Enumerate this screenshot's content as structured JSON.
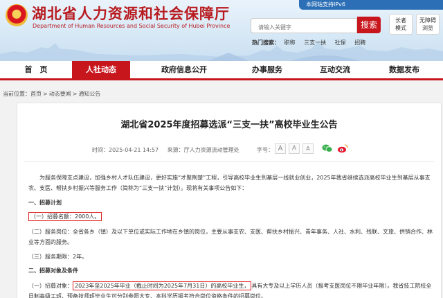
{
  "header": {
    "title": "湖北省人力资源和社会保障厅",
    "subtitle": "Department of Human Resources and Social Security of Hubei Province",
    "ipv6_text": "本网站支持IPv6",
    "search": {
      "placeholder": "请输入关键字",
      "button": "搜索"
    },
    "hot": {
      "label": "热门搜索：",
      "words": [
        "职称",
        "三支一扶",
        "社保",
        "招聘"
      ]
    },
    "elder_line1": "长者",
    "elder_line2": "模式",
    "barrier_line1": "无障碍",
    "barrier_line2": "浏览"
  },
  "nav": {
    "items": [
      "首　页",
      "人社动态",
      "政府信息公开",
      "办事服务",
      "互动交流",
      "数据发布"
    ],
    "active_index": 1
  },
  "breadcrumb": {
    "prefix": "当前位置：",
    "items": [
      "首页",
      "动态要闻",
      "通知公告"
    ],
    "separator": ">"
  },
  "article": {
    "title": "湖北省2025年度招募选派“三支一扶”高校毕业生公告",
    "time_label": "时间：",
    "time": "2025-04-21 14:57",
    "source_label": "来源：",
    "source": "厅人力资源流动管理处",
    "font_label": "字号：",
    "font_buttons": [
      "A",
      "A",
      "A"
    ],
    "intro": "为服务保障支点建设，加强乡村人才队伍建设，更好实施“才聚荆楚”工程，引导高校毕业生到基层一线就业创业，2025年我省继续选派高校毕业生到基层从事支农、支医、帮扶乡村振兴等服务工作（简称为“三支一扶”计划）。现将有关事项公告如下：",
    "section1": "一、招募计划",
    "item1": "（一）招募名额：2000人。",
    "item2": "（二）服务岗位：全省各乡（镇）及以下单位或实际工作地在乡镇的岗位，主要从事支农、支医、帮扶乡村振兴、青年事务、人社、水利、残联、文旅、供销合作、林业等方面的服务。",
    "item3": "（三）服务期限：2年。",
    "section2": "二、招募对象及条件",
    "item4_prefix": "（一）招募对象：",
    "item4_highlight": "2023年至2025年毕业（截止时间为2025年7月31日）的高校毕业生，",
    "item4_suffix": "具有大专及以上学历人员（报考支医岗位不限毕业年限）。我省技工院校全日制高级工班、预备技师班毕业生可分别参照大专、本科学历报考符合岗位资格条件的招募岗位。"
  }
}
